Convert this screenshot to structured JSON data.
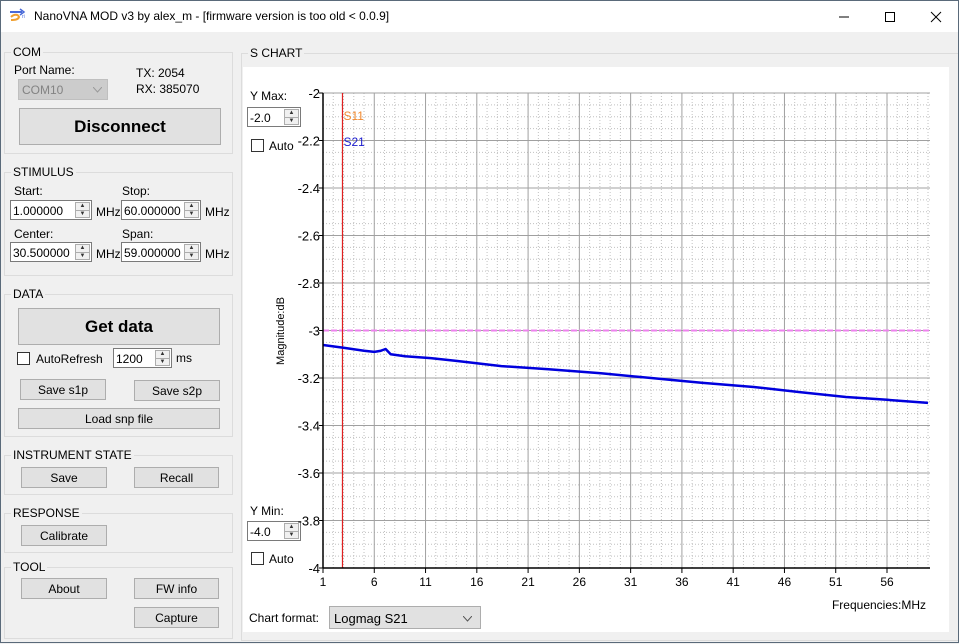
{
  "window": {
    "title": "NanoVNA MOD v3 by alex_m - [firmware version is too old < 0.0.9]",
    "icons": {
      "app": "app-logo-icon",
      "minimize": "minimize-icon",
      "maximize": "maximize-icon",
      "close": "close-icon"
    }
  },
  "com": {
    "group_label": "COM",
    "port_label": "Port Name:",
    "port_value": "COM10",
    "tx": "TX: 2054",
    "rx": "RX: 385070",
    "disconnect_label": "Disconnect"
  },
  "stimulus": {
    "group_label": "STIMULUS",
    "start_label": "Start:",
    "start_value": "1.000000",
    "stop_label": "Stop:",
    "stop_value": "60.000000",
    "center_label": "Center:",
    "center_value": "30.500000",
    "span_label": "Span:",
    "span_value": "59.000000",
    "unit": "MHz"
  },
  "data": {
    "group_label": "DATA",
    "get_data_label": "Get data",
    "autorefresh_label": "AutoRefresh",
    "autorefresh_checked": false,
    "interval_value": "1200",
    "interval_unit": "ms",
    "save_s1p_label": "Save s1p",
    "save_s2p_label": "Save s2p",
    "load_snp_label": "Load snp file"
  },
  "instrument_state": {
    "group_label": "INSTRUMENT STATE",
    "save_label": "Save",
    "recall_label": "Recall"
  },
  "response": {
    "group_label": "RESPONSE",
    "calibrate_label": "Calibrate"
  },
  "tool": {
    "group_label": "TOOL",
    "about_label": "About",
    "fw_info_label": "FW info",
    "capture_label": "Capture"
  },
  "s_chart": {
    "group_label": "S CHART",
    "y_max_label": "Y Max:",
    "y_max_value": "-2.0",
    "y_max_auto_label": "Auto",
    "y_min_label": "Y Min:",
    "y_min_value": "-4.0",
    "y_min_auto_label": "Auto",
    "chart_format_label": "Chart format:",
    "chart_format_value": "Logmag S21"
  },
  "chart_data": {
    "type": "line",
    "title": "",
    "xlabel": "Frequencies:MHz",
    "ylabel": "Magnitude:dB",
    "xlim": [
      1,
      60
    ],
    "ylim": [
      -4,
      -2
    ],
    "x_ticks": [
      1,
      6,
      11,
      16,
      21,
      26,
      31,
      36,
      41,
      46,
      51,
      56
    ],
    "y_ticks": [
      -2,
      -2.2,
      -2.4,
      -2.6,
      -2.8,
      -3,
      -3.2,
      -3.4,
      -3.6,
      -3.8,
      -4
    ],
    "grid": true,
    "legend": [
      {
        "name": "S11",
        "color": "#f08a30"
      },
      {
        "name": "S21",
        "color": "#1a1acc"
      }
    ],
    "legend_position": "top-left",
    "marker": {
      "x": 2.9,
      "color": "#e02020"
    },
    "reference_line": {
      "y": -3.0,
      "color": "#ee82ee",
      "style": "dashed"
    },
    "series": [
      {
        "name": "S21",
        "color": "#0000dd",
        "x": [
          1,
          3,
          5,
          6,
          6.6,
          7.1,
          7.6,
          9,
          11.5,
          14,
          18.4,
          23,
          28.1,
          33,
          37.9,
          43,
          47.6,
          52,
          56,
          60
        ],
        "y": [
          -3.061,
          -3.073,
          -3.085,
          -3.09,
          -3.086,
          -3.078,
          -3.1,
          -3.108,
          -3.116,
          -3.128,
          -3.15,
          -3.163,
          -3.18,
          -3.2,
          -3.22,
          -3.238,
          -3.26,
          -3.28,
          -3.292,
          -3.305
        ]
      }
    ]
  }
}
